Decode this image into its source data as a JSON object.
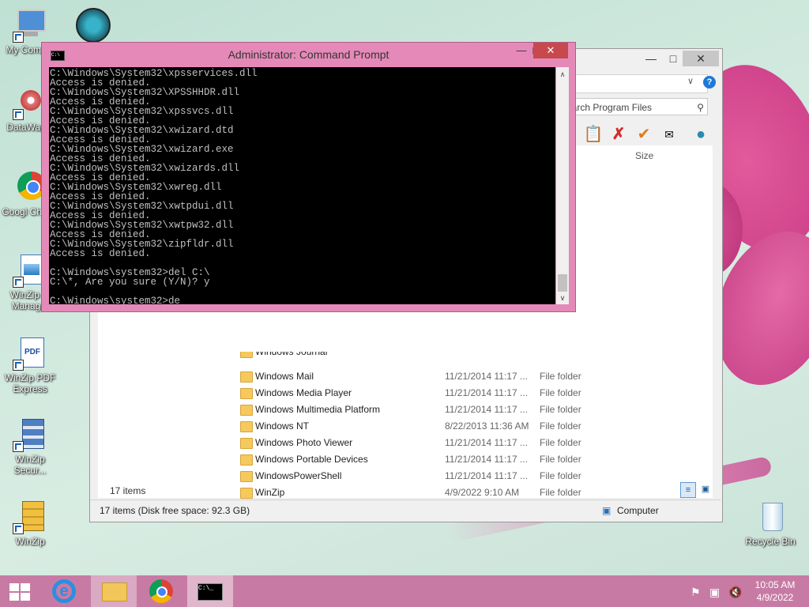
{
  "desktop": {
    "icons": [
      {
        "label": "My Comp..."
      },
      {
        "label": "DataWag..."
      },
      {
        "label": "Googl Chrom"
      },
      {
        "label": "WinZip In Manag..."
      },
      {
        "label": "WinZip PDF Express"
      },
      {
        "label": "WinZip Secur..."
      },
      {
        "label": "WinZip"
      },
      {
        "label": "Recycle Bin"
      }
    ]
  },
  "explorer": {
    "search_placeholder": "Search Program Files",
    "column_size": "Size",
    "rows": [
      {
        "name": "Windows Journal",
        "date": "",
        "type": ""
      },
      {
        "name": "Windows Mail",
        "date": "11/21/2014 11:17 ...",
        "type": "File folder"
      },
      {
        "name": "Windows Media Player",
        "date": "11/21/2014 11:17 ...",
        "type": "File folder"
      },
      {
        "name": "Windows Multimedia Platform",
        "date": "11/21/2014 11:17 ...",
        "type": "File folder"
      },
      {
        "name": "Windows NT",
        "date": "8/22/2013 11:36 AM",
        "type": "File folder"
      },
      {
        "name": "Windows Photo Viewer",
        "date": "11/21/2014 11:17 ...",
        "type": "File folder"
      },
      {
        "name": "Windows Portable Devices",
        "date": "11/21/2014 11:17 ...",
        "type": "File folder"
      },
      {
        "name": "WindowsPowerShell",
        "date": "11/21/2014 11:17 ...",
        "type": "File folder"
      },
      {
        "name": "WinZip",
        "date": "4/9/2022 9:10 AM",
        "type": "File folder"
      }
    ],
    "items_count": "17 items",
    "status_text": "17 items (Disk free space: 92.3 GB)",
    "status_location": "Computer"
  },
  "cmd": {
    "title": "Administrator: Command Prompt",
    "lines": [
      "C:\\Windows\\System32\\xpsservices.dll",
      "Access is denied.",
      "C:\\Windows\\System32\\XPSSHHDR.dll",
      "Access is denied.",
      "C:\\Windows\\System32\\xpssvcs.dll",
      "Access is denied.",
      "C:\\Windows\\System32\\xwizard.dtd",
      "Access is denied.",
      "C:\\Windows\\System32\\xwizard.exe",
      "Access is denied.",
      "C:\\Windows\\System32\\xwizards.dll",
      "Access is denied.",
      "C:\\Windows\\System32\\xwreg.dll",
      "Access is denied.",
      "C:\\Windows\\System32\\xwtpdui.dll",
      "Access is denied.",
      "C:\\Windows\\System32\\xwtpw32.dll",
      "Access is denied.",
      "C:\\Windows\\System32\\zipfldr.dll",
      "Access is denied.",
      "",
      "C:\\Windows\\system32>del C:\\",
      "C:\\*, Are you sure (Y/N)? y",
      "",
      "C:\\Windows\\system32>de"
    ]
  },
  "taskbar": {
    "time": "10:05 AM",
    "date": "4/9/2022"
  },
  "colors": {
    "taskbar": "#c77ba4",
    "cmd_frame": "#e58ab8",
    "close_button": "#c8494d"
  }
}
